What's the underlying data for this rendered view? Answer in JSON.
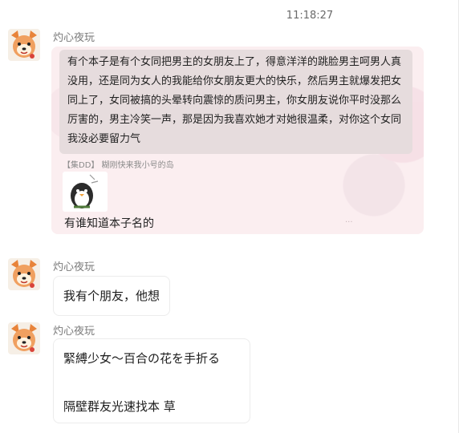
{
  "chat": {
    "timestamp": "11:18:27",
    "messages": [
      {
        "sender": "灼心夜玩",
        "quoted_text": "有个本子是有个女同把男主的女朋友上了，得意洋洋的跳脸男主呵男人真没用，还是同为女人的我能给你女朋友更大的快乐，然后男主就爆发把女同上了，女同被搞的头晕转向震惊的质问男主，你女朋友说你平时没那么厉害的，男主冷笑一声，那是因为我喜欢她才对她很温柔，对你这个女同我没必要留力气",
        "reply_reference": "【集DD】 糊刚快来我小号的岛",
        "sticker": "penguin-sticker",
        "text": "有谁知道本子名的",
        "watermark": "···"
      },
      {
        "sender": "灼心夜玩",
        "text": "我有个朋友，他想"
      },
      {
        "sender": "灼心夜玩",
        "line1": "緊縛少女～百合の花を手折る",
        "line2": "隔壁群友光速找本 草"
      }
    ]
  }
}
